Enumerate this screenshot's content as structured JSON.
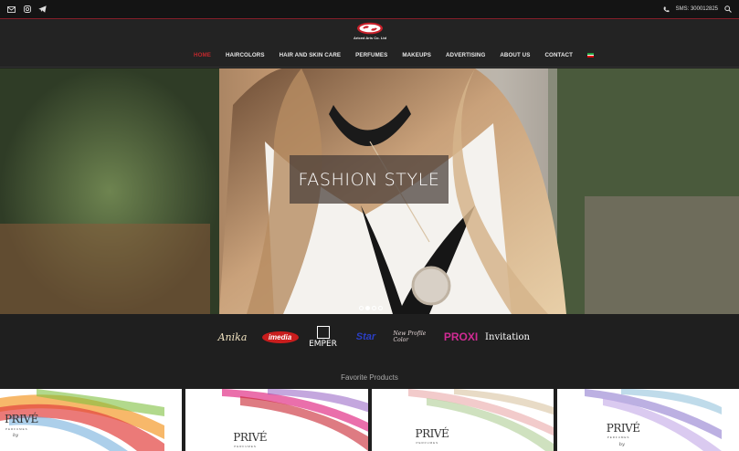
{
  "topbar": {
    "left_icons": [
      "mail-icon",
      "instagram-icon",
      "telegram-icon"
    ],
    "sms_label": "SMS: 300012825",
    "right_icons": [
      "phone-icon",
      "search-icon"
    ]
  },
  "logo": {
    "text": "Ariced Aris Co. Ltd"
  },
  "nav": {
    "items": [
      {
        "label": "HOME",
        "active": true
      },
      {
        "label": "HAIRCOLORS",
        "active": false
      },
      {
        "label": "HAIR AND SKIN CARE",
        "active": false
      },
      {
        "label": "PERFUMES",
        "active": false
      },
      {
        "label": "MAKEUPS",
        "active": false
      },
      {
        "label": "ADVERTISING",
        "active": false
      },
      {
        "label": "ABOUT US",
        "active": false
      },
      {
        "label": "CONTACT",
        "active": false
      }
    ],
    "language_icon": "iran-flag-icon",
    "active_color": "#c0282d"
  },
  "hero": {
    "caption": "FASHION STYLE",
    "slides": 4,
    "current_slide": 2
  },
  "brands": {
    "anika": "Anika",
    "imedia": "imedia",
    "emper": "EMPER",
    "star": "Star",
    "newprofile": "New Profile Color",
    "proxi": "PROXI",
    "invitation": "Invitation"
  },
  "favorites": {
    "title": "Favorite Products",
    "products": [
      {
        "name": "PRIVÉ",
        "sub": "PERFUMES",
        "by": "by"
      },
      {
        "name": "PRIVÉ",
        "sub": "PERFUMES",
        "by": ""
      },
      {
        "name": "PRIVÉ",
        "sub": "PERFUMES",
        "by": ""
      },
      {
        "name": "PRIVÉ",
        "sub": "PERFUMES",
        "by": "by"
      }
    ]
  },
  "colors": {
    "topbar_bg": "#141414",
    "header_bg": "#232323",
    "accent_red": "#c0282d",
    "page_bg": "#1f1f1f"
  }
}
